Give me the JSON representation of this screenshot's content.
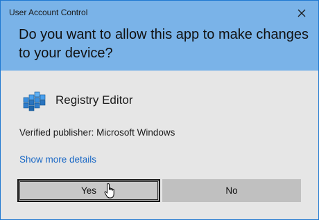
{
  "dialog": {
    "title": "User Account Control",
    "question": "Do you want to allow this app to make changes to your device?",
    "app_name": "Registry Editor",
    "publisher": "Verified publisher: Microsoft Windows",
    "details_link": "Show more details",
    "yes_label": "Yes",
    "no_label": "No",
    "close_icon": "close-icon",
    "app_icon": "registry-editor-icon",
    "colors": {
      "frame": "#1f78d1",
      "header": "#7ab3e8",
      "body": "#e6e6e6",
      "link": "#1a68c5"
    }
  }
}
